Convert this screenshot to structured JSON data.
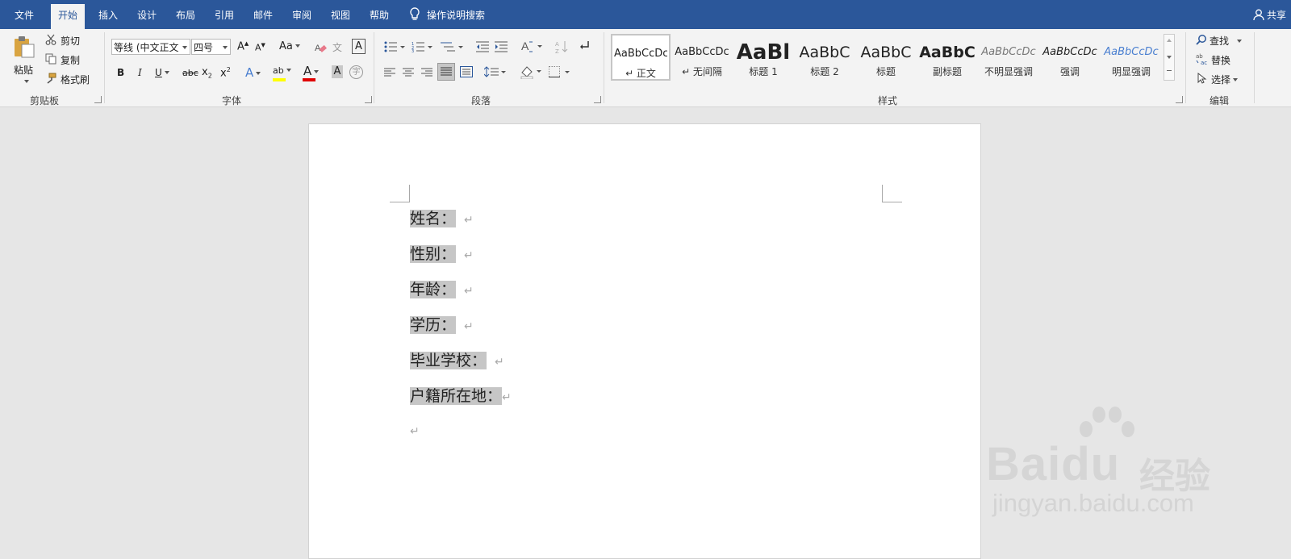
{
  "tabs": {
    "file": "文件",
    "home": "开始",
    "insert": "插入",
    "design": "设计",
    "layout": "布局",
    "references": "引用",
    "mailings": "邮件",
    "review": "审阅",
    "view": "视图",
    "help": "帮助"
  },
  "tell_me": "操作说明搜索",
  "share": "共享",
  "clipboard": {
    "paste": "粘贴",
    "cut": "剪切",
    "copy": "复制",
    "format_painter": "格式刷",
    "label": "剪贴板"
  },
  "font": {
    "name": "等线 (中文正文",
    "size": "四号",
    "grow": "A",
    "shrink": "A",
    "change_case": "Aa",
    "phonetic": "文",
    "border_char": "A",
    "bold": "B",
    "italic": "I",
    "underline": "U",
    "strike": "abc",
    "subscript": "x",
    "superscript": "x",
    "sub_mark": "2",
    "sup_mark": "2",
    "text_effect": "A",
    "highlight_text": "ab",
    "font_color": "A",
    "char_shading": "A",
    "enclose": "字",
    "label": "字体"
  },
  "paragraph": {
    "label": "段落"
  },
  "styles": {
    "label": "样式",
    "items": [
      {
        "sample": "AaBbCcDc",
        "name": "↵ 正文"
      },
      {
        "sample": "AaBbCcDc",
        "name": "↵ 无间隔"
      },
      {
        "sample": "AaBl",
        "name": "标题 1"
      },
      {
        "sample": "AaBbC",
        "name": "标题 2"
      },
      {
        "sample": "AaBbC",
        "name": "标题"
      },
      {
        "sample": "AaBbC",
        "name": "副标题"
      },
      {
        "sample": "AaBbCcDc",
        "name": "不明显强调"
      },
      {
        "sample": "AaBbCcDc",
        "name": "强调"
      },
      {
        "sample": "AaBbCcDc",
        "name": "明显强调"
      }
    ]
  },
  "editing": {
    "find": "查找",
    "replace": "替换",
    "select": "选择",
    "label": "编辑"
  },
  "document": {
    "lines": [
      {
        "text": "姓名：",
        "mark": "↵"
      },
      {
        "text": "性别：",
        "mark": "↵"
      },
      {
        "text": "年龄：",
        "mark": "↵"
      },
      {
        "text": "学历：",
        "mark": "↵"
      },
      {
        "text": "毕业学校：",
        "mark": "↵"
      },
      {
        "text": "户籍所在地：",
        "mark": "↵"
      }
    ],
    "empty_mark": "↵"
  },
  "watermark": {
    "main": "Bai",
    "paw": "du",
    "cn": "经验",
    "url": "jingyan.baidu.com"
  },
  "colors": {
    "title_bar": "#2b579a",
    "ribbon": "#f3f3f3",
    "highlight": "#c6c6c6",
    "font_color_bar": "#e00000",
    "highlight_bar": "#ffff00"
  }
}
